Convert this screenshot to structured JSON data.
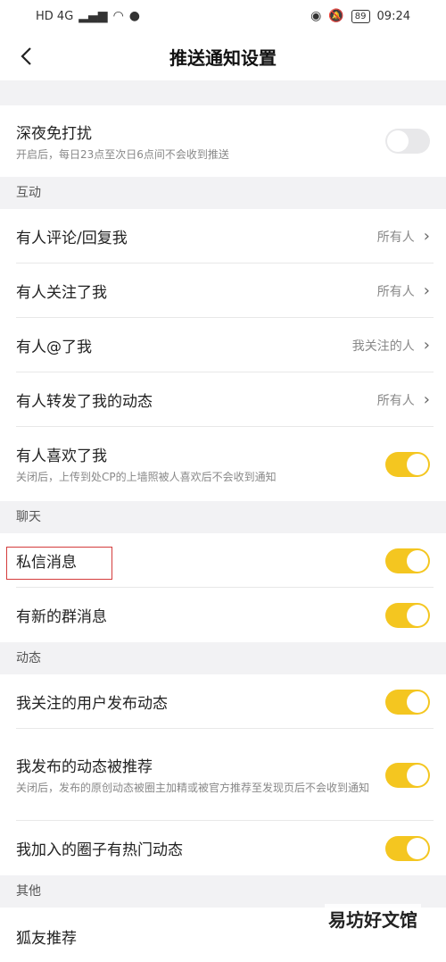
{
  "status": {
    "net": "HD 4G",
    "battery": "89",
    "time": "09:24"
  },
  "nav": {
    "title": "推送通知设置"
  },
  "night": {
    "title": "深夜免打扰",
    "desc": "开启后，每日23点至次日6点间不会收到推送",
    "enabled": false
  },
  "sections": {
    "interaction": "互动",
    "chat": "聊天",
    "moments": "动态",
    "other": "其他"
  },
  "interaction": {
    "comment": {
      "title": "有人评论/回复我",
      "value": "所有人"
    },
    "follow": {
      "title": "有人关注了我",
      "value": "所有人"
    },
    "mention": {
      "title": "有人@了我",
      "value": "我关注的人"
    },
    "repost": {
      "title": "有人转发了我的动态",
      "value": "所有人"
    },
    "like": {
      "title": "有人喜欢了我",
      "desc": "关闭后，上传到处CP的上墙照被人喜欢后不会收到通知",
      "enabled": true
    }
  },
  "chat": {
    "dm": {
      "title": "私信消息",
      "enabled": true
    },
    "group": {
      "title": "有新的群消息",
      "enabled": true
    }
  },
  "moments": {
    "following": {
      "title": "我关注的用户发布动态",
      "enabled": true
    },
    "recommended": {
      "title": "我发布的动态被推荐",
      "desc": "关闭后，发布的原创动态被圈主加精或被官方推荐至发现页后不会收到通知",
      "enabled": true
    },
    "circle": {
      "title": "我加入的圈子有热门动态",
      "enabled": true
    }
  },
  "other": {
    "fox": {
      "title": "狐友推荐"
    }
  },
  "watermark": "易坊好文馆",
  "colors": {
    "accent": "#f4c620",
    "highlight": "#d43c3c"
  }
}
